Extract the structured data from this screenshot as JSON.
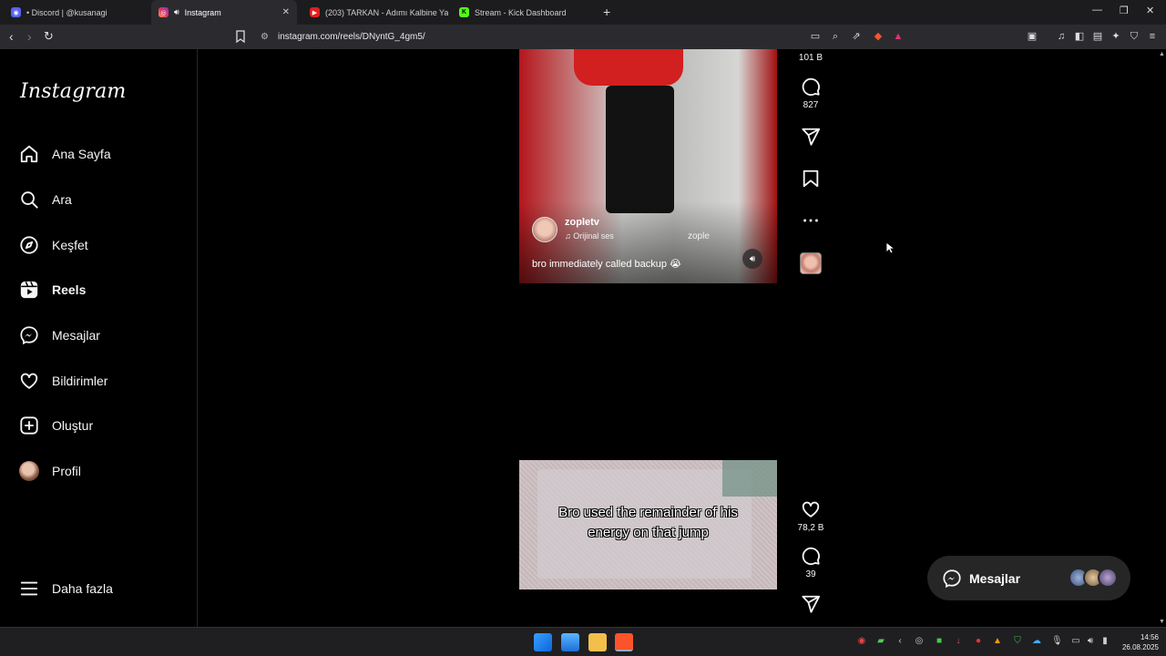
{
  "browser": {
    "tabs": [
      {
        "title": "• Discord | @kusanagi",
        "icon": "discord-icon"
      },
      {
        "title": "Instagram",
        "icon": "instagram-icon",
        "active": true
      },
      {
        "title": "(203) TARKAN - Adımı Kalbine Yaz (O",
        "icon": "youtube-icon"
      },
      {
        "title": "Stream - Kick Dashboard",
        "icon": "kick-icon"
      }
    ],
    "url": "instagram.com/reels/DNyntG_4gm5/"
  },
  "instagram": {
    "logo": "Instagram",
    "nav": [
      {
        "label": "Ana Sayfa",
        "icon": "home-icon"
      },
      {
        "label": "Ara",
        "icon": "search-icon"
      },
      {
        "label": "Keşfet",
        "icon": "compass-icon"
      },
      {
        "label": "Reels",
        "icon": "reels-icon",
        "active": true
      },
      {
        "label": "Mesajlar",
        "icon": "messenger-icon"
      },
      {
        "label": "Bildirimler",
        "icon": "heart-icon"
      },
      {
        "label": "Oluştur",
        "icon": "create-icon"
      },
      {
        "label": "Profil",
        "icon": "avatar"
      }
    ],
    "more_label": "Daha fazla"
  },
  "reel1": {
    "username": "zopletv",
    "audio": "Orijinal ses",
    "audio_owner": "zople",
    "caption": "bro immediately called backup 😭",
    "likes": "101 B",
    "comments": "827"
  },
  "reel2": {
    "overlay_text": "Bro used the remainder of his energy on that jump",
    "likes": "78,2 B",
    "comments": "39"
  },
  "messages_pill": {
    "label": "Mesajlar"
  },
  "taskbar": {
    "time": "14:56",
    "date": "26.08.2025"
  },
  "colors": {
    "background": "#000000",
    "sidebar_border": "#262626",
    "pill": "#262626",
    "chrome": "#2b2b2f"
  }
}
